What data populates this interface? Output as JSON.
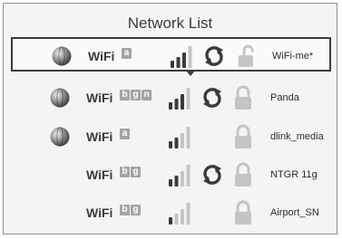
{
  "title": "Network List",
  "networks": [
    {
      "label": "WiFi",
      "badges": [
        "a"
      ],
      "ssid": "WiFi-me*",
      "selected": true,
      "globe": true,
      "sync": true,
      "locked": false,
      "signal_bars": 3
    },
    {
      "label": "WiFi",
      "badges": [
        "b",
        "g",
        "n"
      ],
      "ssid": "Panda",
      "selected": false,
      "globe": true,
      "sync": true,
      "locked": true,
      "signal_bars": 3
    },
    {
      "label": "WiFi",
      "badges": [
        "a"
      ],
      "ssid": "dlink_media",
      "selected": false,
      "globe": true,
      "sync": false,
      "locked": true,
      "signal_bars": 2
    },
    {
      "label": "WiFi",
      "badges": [
        "b",
        "g"
      ],
      "ssid": "NTGR 11g",
      "selected": false,
      "globe": false,
      "sync": true,
      "locked": true,
      "signal_bars": 2
    },
    {
      "label": "WiFi",
      "badges": [
        "b",
        "g"
      ],
      "ssid": "Airport_SN",
      "selected": false,
      "globe": false,
      "sync": false,
      "locked": true,
      "signal_bars": 1
    }
  ],
  "colors": {
    "icon_dark": "#3a3a3a",
    "icon_light": "#c4c4c4",
    "border": "#8e8e8e",
    "badge": "#a4a4a4"
  },
  "icons": [
    "globe-icon",
    "signal-strength-icon",
    "sync-icon",
    "lock-icon",
    "unlock-icon"
  ]
}
